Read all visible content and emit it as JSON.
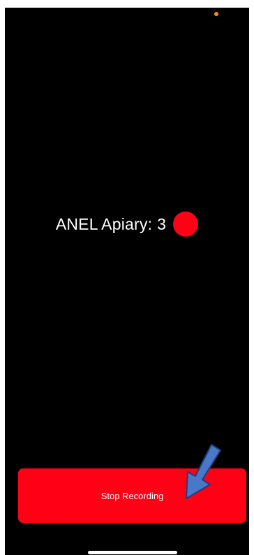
{
  "status": {
    "apiary_label": "ANEL Apiary:",
    "count": "3",
    "indicator_color": "#ff0015"
  },
  "actions": {
    "stop_recording_label": "Stop Recording"
  },
  "annotation": {
    "arrow_icon": "arrow-down-left-icon",
    "arrow_color": "#4a78c9"
  },
  "system": {
    "privacy_indicator_color": "#ff8a1f"
  }
}
